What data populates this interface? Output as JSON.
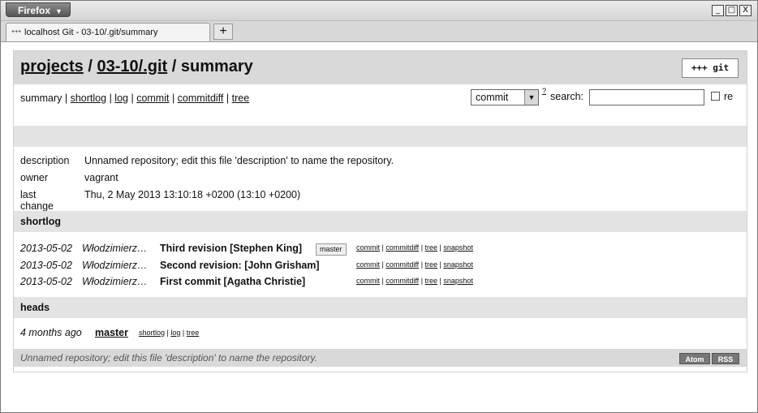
{
  "browser": {
    "menu_label": "Firefox",
    "tab_title": "localhost Git - 03-10/.git/summary",
    "new_tab": "+",
    "controls": [
      "_",
      "□",
      "X"
    ]
  },
  "page": {
    "breadcrumb": {
      "projects": "projects",
      "sep1": " / ",
      "repo": "03-10/.git",
      "sep2": " / ",
      "current": "summary"
    },
    "logo_text": "+++ git",
    "nav": [
      {
        "label": "summary",
        "link": false
      },
      {
        "label": "shortlog",
        "link": true
      },
      {
        "label": "log",
        "link": true
      },
      {
        "label": "commit",
        "link": true
      },
      {
        "label": "commitdiff",
        "link": true
      },
      {
        "label": "tree",
        "link": true
      }
    ],
    "search": {
      "select_value": "commit",
      "help_sup": "?",
      "label": "search:",
      "input_value": "",
      "regex_label": "re"
    },
    "meta": [
      {
        "key": "description",
        "value": "Unnamed repository; edit this file 'description' to name the repository."
      },
      {
        "key": "owner",
        "value": "vagrant"
      },
      {
        "key": "last change",
        "value": "Thu, 2 May 2013 13:10:18 +0200 (13:10 +0200)"
      }
    ],
    "shortlog": {
      "title": "shortlog",
      "rows": [
        {
          "date": "2013-05-02",
          "author": "Włodzimierz…",
          "title": "Third revision [Stephen King]",
          "ref": "master"
        },
        {
          "date": "2013-05-02",
          "author": "Włodzimierz…",
          "title": "Second revision: [John Grisham]",
          "ref": ""
        },
        {
          "date": "2013-05-02",
          "author": "Włodzimierz…",
          "title": "First commit [Agatha Christie]",
          "ref": ""
        }
      ],
      "links": [
        "commit",
        "commitdiff",
        "tree",
        "snapshot"
      ]
    },
    "heads": {
      "title": "heads",
      "age": "4 months ago",
      "name": "master",
      "links": [
        "shortlog",
        "log",
        "tree"
      ]
    },
    "footer": {
      "description": "Unnamed repository; edit this file 'description' to name the repository.",
      "atom": "Atom",
      "rss": "RSS"
    }
  }
}
